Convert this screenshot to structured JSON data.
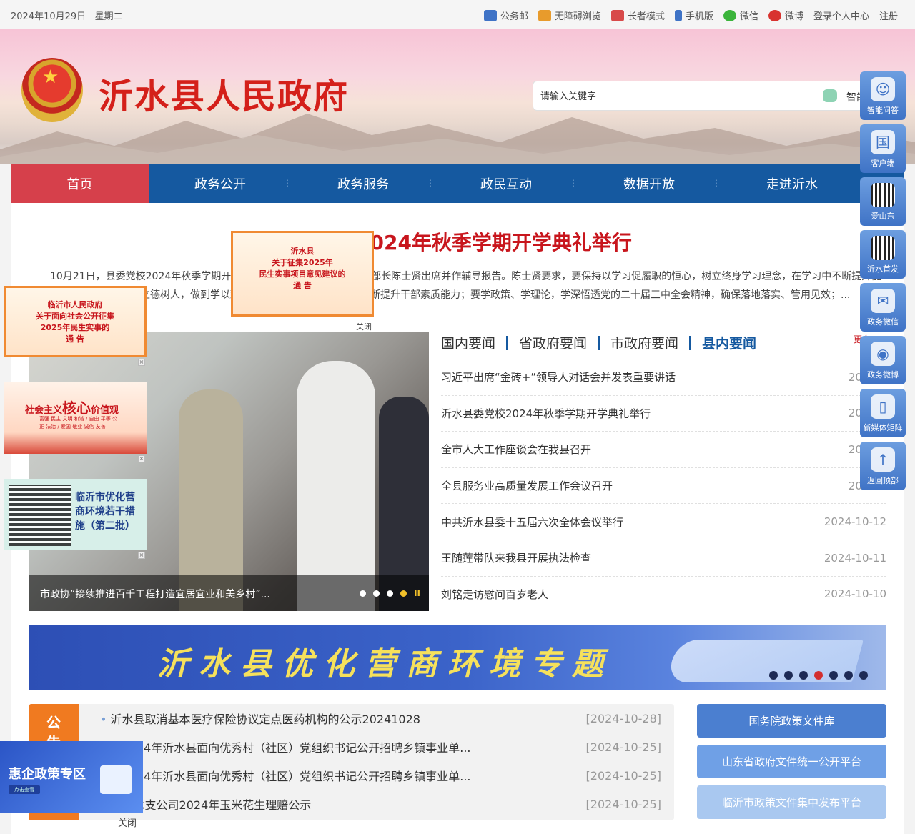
{
  "topbar": {
    "date": "2024年10月29日",
    "weekday": "星期二",
    "links": [
      {
        "label": "公务邮",
        "icon": "mail-icon",
        "color": "#3f73c6"
      },
      {
        "label": "无障碍浏览",
        "icon": "accessibility-icon",
        "color": "#e89b2c"
      },
      {
        "label": "长者模式",
        "icon": "elder-icon",
        "color": "#d84a4a"
      },
      {
        "label": "手机版",
        "icon": "mobile-icon",
        "color": "#3f73c6"
      },
      {
        "label": "微信",
        "icon": "wechat-icon",
        "color": "#3bb43b"
      },
      {
        "label": "微博",
        "icon": "weibo-icon",
        "color": "#d8332f"
      }
    ],
    "login": "登录个人中心",
    "register": "注册"
  },
  "header": {
    "title": "沂水县人民政府",
    "search_placeholder": "请输入关键字",
    "smart_label": "智能"
  },
  "nav": {
    "items": [
      "首页",
      "政务公开",
      "政务服务",
      "政民互动",
      "数据开放",
      "走进沂水"
    ],
    "sep": "⋮"
  },
  "headline": {
    "title": "沂水县委党校2024年秋季学期开学典礼举行",
    "summary": "10月21日，县委党校2024年秋季学期开学典礼举行。县委常委、组织部部长陈士贤出席并作辅导报告。陈士贤要求，要保持以学习促履职的恒心，树立终身学习理念，在学习中不断提升能力素质，结合全环境立德树人，做到学以致用、用以促学，学用相长，不断提升干部素质能力；要学政策、学理论，学深悟透党的二十届三中全会精神，确保落地落实、管用见效；..."
  },
  "popups": {
    "notice1": {
      "line1": "沂水县",
      "line2": "关于征集2025年",
      "line3": "民生实事项目意见建议的",
      "line4": "通 告",
      "close": "关闭"
    },
    "notice2": {
      "line1": "临沂市人民政府",
      "line2": "关于面向社会公开征集",
      "line3": "2025年民生实事的",
      "line4": "通 告"
    },
    "values": {
      "a": "社会主义",
      "b": "核心",
      "c": "价值观",
      "d": "富强 民主 文明 和谐 / 自由 平等 公正 法治 / 爱国 敬业 诚信 友善"
    },
    "business": {
      "t": "临沂市优化营商环境若干措施（第二批）"
    },
    "policy": {
      "t": "惠企政策专区",
      "b": "点击查看",
      "close": "关闭"
    }
  },
  "slider": {
    "caption": "市政协“接续推进百千工程打造宜居宜业和美乡村”...",
    "dots": 4,
    "active_dot": 4,
    "pause": "II"
  },
  "news": {
    "tabs": [
      "国内要闻",
      "省政府要闻",
      "市政府要闻",
      "县内要闻"
    ],
    "active_tab": 3,
    "more": "更多",
    "items": [
      {
        "title": "习近平出席“金砖+”领导人对话会并发表重要讲话",
        "date": "2024-1"
      },
      {
        "title": "沂水县委党校2024年秋季学期开学典礼举行",
        "date": "2024-1"
      },
      {
        "title": "全市人大工作座谈会在我县召开",
        "date": "2024-1"
      },
      {
        "title": "全县服务业高质量发展工作会议召开",
        "date": "2024-1"
      },
      {
        "title": "中共沂水县委十五届六次全体会议举行",
        "date": "2024-10-12"
      },
      {
        "title": "王随莲带队来我县开展执法检查",
        "date": "2024-10-11"
      },
      {
        "title": "刘铭走访慰问百岁老人",
        "date": "2024-10-10"
      }
    ]
  },
  "banner": {
    "title": "沂水县优化营商环境专题",
    "dots": 7,
    "active_dot": 4
  },
  "notices": {
    "tag": "公告",
    "items": [
      {
        "title": "沂水县取消基本医疗保险协议定点医药机构的公示20241028",
        "date": "[2024-10-28]"
      },
      {
        "title": "布2024年沂水县面向优秀村（社区）党组织书记公开招聘乡镇事业单...",
        "date": "[2024-10-25]"
      },
      {
        "title": "布2024年沂水县面向优秀村（社区）党组织书记公开招聘乡镇事业单...",
        "date": "[2024-10-25]"
      },
      {
        "title": "险沂水支公司2024年玉米花生理赔公示",
        "date": "[2024-10-25]"
      }
    ]
  },
  "policy_links": [
    "国务院政策文件库",
    "山东省政府文件统一公开平台",
    "临沂市政策文件集中发布平台"
  ],
  "sidebar": [
    {
      "label": "智能问答",
      "icon": "robot-icon",
      "glyph": "☺"
    },
    {
      "label": "客户端",
      "icon": "state-council-app-icon",
      "glyph": "国"
    },
    {
      "label": "爱山东",
      "icon": "qr-code-icon",
      "glyph": ""
    },
    {
      "label": "沂水首发",
      "icon": "qr-code-icon",
      "glyph": ""
    },
    {
      "label": "政务微信",
      "icon": "wechat-icon",
      "glyph": "✉"
    },
    {
      "label": "政务微博",
      "icon": "weibo-icon",
      "glyph": "◉"
    },
    {
      "label": "新媒体矩阵",
      "icon": "phone-icon",
      "glyph": "▯"
    },
    {
      "label": "返回顶部",
      "icon": "arrow-up-icon",
      "glyph": "↑"
    }
  ]
}
